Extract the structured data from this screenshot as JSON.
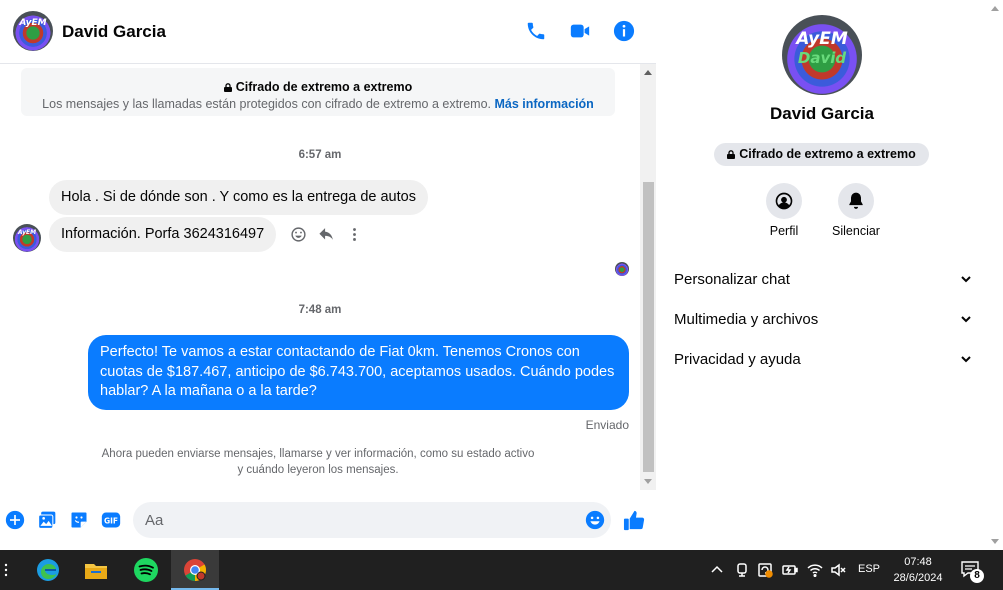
{
  "header": {
    "contact_name": "David Garcia",
    "avatar_text": "AyEM"
  },
  "e2e": {
    "title": "Cifrado de extremo a extremo",
    "subtitle": "Los mensajes y las llamadas están protegidos con cifrado de extremo a extremo.",
    "link": "Más información"
  },
  "messages": {
    "time1": "6:57 am",
    "incoming": [
      "Hola . Si de dónde son . Y como es la entrega de autos",
      "Información. Porfa 3624316497"
    ],
    "time2": "7:48 am",
    "outgoing": "Perfecto! Te vamos a estar contactando de Fiat 0km. Tenemos Cronos con cuotas de $187.467, anticipo de $6.743.700, aceptamos usados. Cuándo podes hablar? A la mañana o a la tarde?",
    "status": "Enviado",
    "info_note": "Ahora pueden enviarse mensajes, llamarse y ver información, como su estado activo y cuándo leyeron los mensajes."
  },
  "composer": {
    "placeholder": "Aa"
  },
  "panel": {
    "name": "David Garcia",
    "avatar_text": "AyEM",
    "avatar_subtext": "David",
    "e2e_pill": "Cifrado de extremo a extremo",
    "actions": [
      {
        "label": "Perfil",
        "icon": "user-circle-icon"
      },
      {
        "label": "Silenciar",
        "icon": "bell-icon"
      }
    ],
    "sections": [
      "Personalizar chat",
      "Multimedia y archivos",
      "Privacidad y ayuda"
    ]
  },
  "taskbar": {
    "language": "ESP",
    "time": "07:48",
    "date": "28/6/2024",
    "notification_count": "8",
    "apps": [
      "edge-icon",
      "file-explorer-icon",
      "spotify-icon",
      "chrome-icon"
    ]
  },
  "colors": {
    "accent": "#0a7cff",
    "incoming_bubble": "#f0f0f0",
    "taskbar": "#202020"
  }
}
